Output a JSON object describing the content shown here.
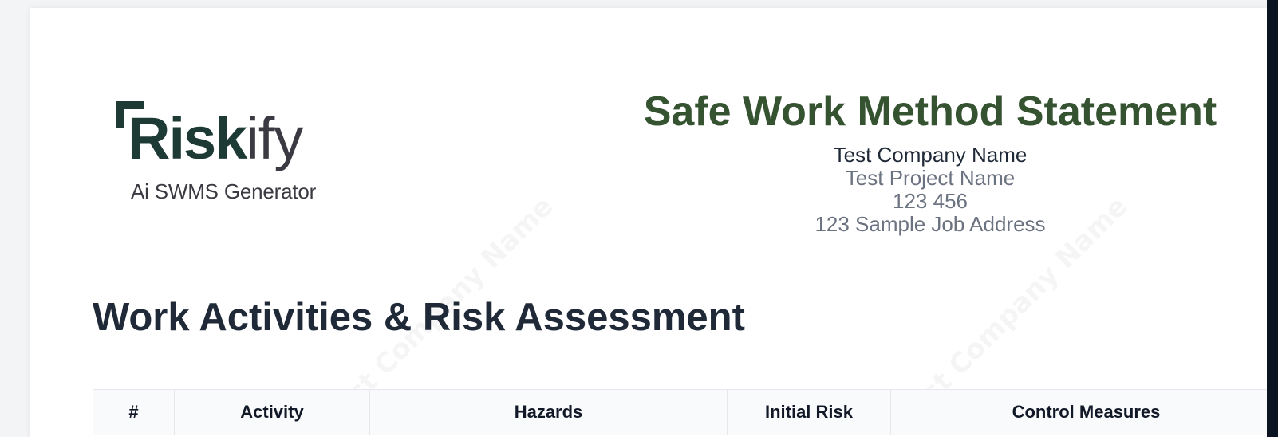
{
  "logo": {
    "brand_main": "Risk",
    "brand_tail": "ify",
    "tagline": "Ai SWMS Generator"
  },
  "header": {
    "title": "Safe Work Method Statement",
    "company_name": "Test Company Name",
    "project_name": "Test Project Name",
    "project_number": "123 456",
    "job_address": "123 Sample Job Address"
  },
  "section": {
    "heading": "Work Activities & Risk Assessment"
  },
  "watermark": {
    "text": "Test Company Name"
  },
  "table": {
    "columns": [
      "#",
      "Activity",
      "Hazards",
      "Initial Risk",
      "Control Measures"
    ]
  },
  "colors": {
    "title_green": "#355331",
    "brand_dark": "#1e3a34",
    "text_dark": "#1f2937",
    "meta_gray": "#6b7280"
  }
}
